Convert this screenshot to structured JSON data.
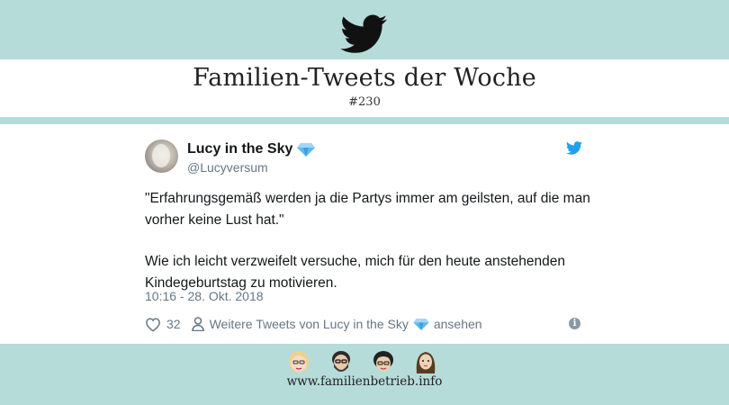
{
  "header": {
    "title": "Familien-Tweets der Woche",
    "issue": "#230"
  },
  "tweet": {
    "author_name": "Lucy in the Sky",
    "author_handle": "@Lucyversum",
    "paragraphs": [
      "\"Erfahrungsgemäß werden ja die Partys immer am geilsten, auf die man vorher keine Lust hat.\"",
      "Wie ich leicht verzweifelt versuche, mich für den heute anstehenden Kindegeburtstag zu motivieren."
    ],
    "timestamp": "10:16 - 28. Okt. 2018",
    "likes": "32",
    "more_tweets_prefix": "Weitere Tweets von Lucy in the Sky",
    "more_tweets_suffix": "ansehen"
  },
  "footer": {
    "url": "www.familienbetrieb.info"
  },
  "colors": {
    "band": "#b5dcd9",
    "twitter_blue": "#1da1f2",
    "text_dark": "#14171a",
    "text_muted": "#657786"
  },
  "icons": [
    "twitter-bird-icon",
    "gem-icon",
    "heart-icon",
    "person-icon",
    "info-icon"
  ]
}
